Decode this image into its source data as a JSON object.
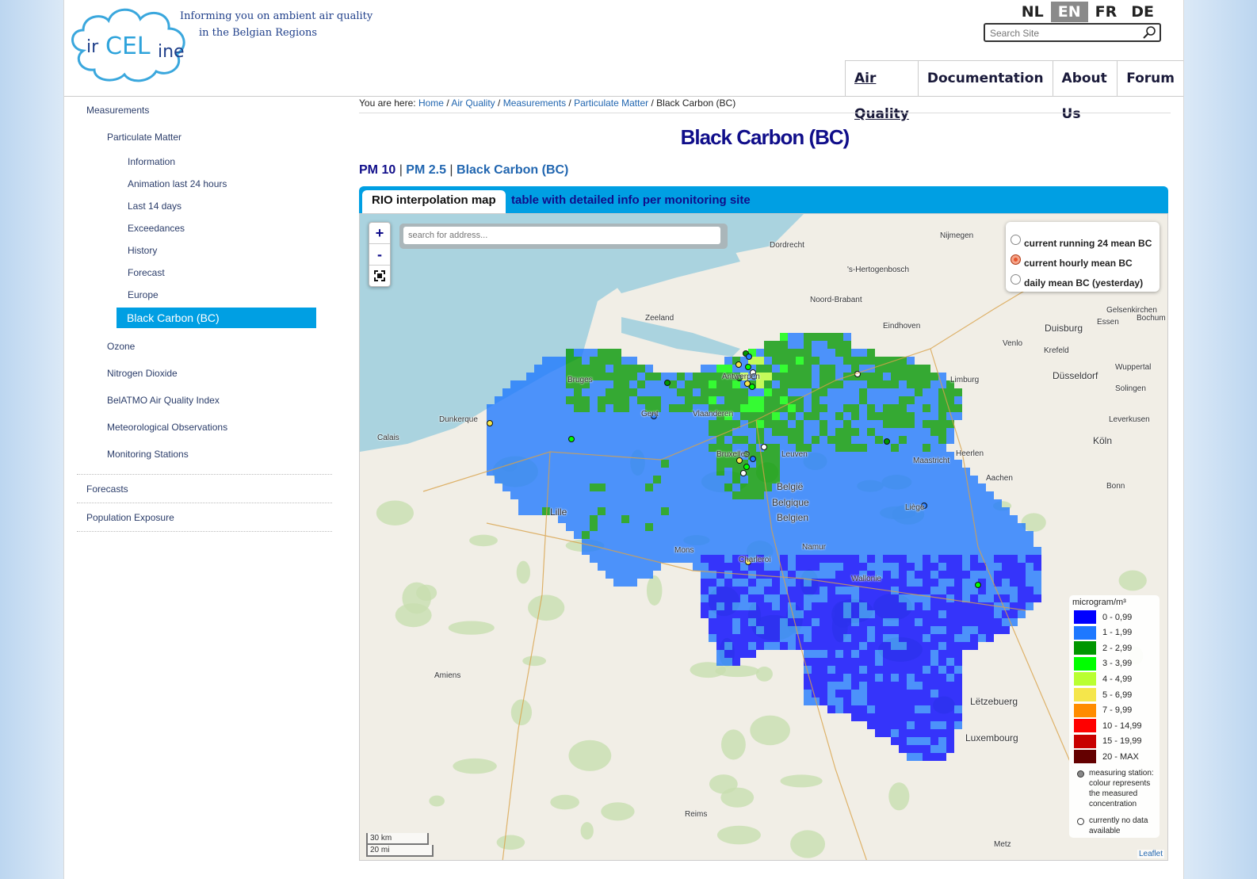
{
  "header": {
    "logo_text_ir": "ir",
    "logo_text_celine": "CEL",
    "logo_text_ine": "ine",
    "tagline_line1": "Informing you on ambient air quality",
    "tagline_line2": "in the Belgian Regions",
    "languages": [
      "NL",
      "EN",
      "FR",
      "DE"
    ],
    "active_language": "EN",
    "search_placeholder": "Search Site",
    "nav": [
      "Air Quality",
      "Documentation",
      "About Us",
      "Forum"
    ]
  },
  "sidebar": {
    "measurements": "Measurements",
    "particulate_matter": "Particulate Matter",
    "pm_items": [
      "Information",
      "Animation last 24 hours",
      "Last 14 days",
      "Exceedances",
      "History",
      "Forecast",
      "Europe"
    ],
    "current": "Black Carbon (BC)",
    "other": [
      "Ozone",
      "Nitrogen Dioxide",
      "BelATMO Air Quality Index",
      "Meteorological Observations",
      "Monitoring Stations"
    ],
    "forecasts": "Forecasts",
    "population": "Population Exposure"
  },
  "breadcrumb": {
    "prefix": "You are here:",
    "links": [
      "Home",
      "Air Quality",
      "Measurements",
      "Particulate Matter"
    ],
    "current": "Black Carbon (BC)"
  },
  "page_title": "Black Carbon (BC)",
  "subnav": {
    "pm10": "PM 10",
    "pm25": "PM 2.5",
    "bc": "Black Carbon (BC)"
  },
  "tabs": {
    "active": "RIO interpolation map",
    "other": "table with detailed info per monitoring site"
  },
  "map": {
    "zoom_in": "+",
    "zoom_out": "-",
    "address_placeholder": "search for address...",
    "options": [
      "current running 24 mean BC",
      "current hourly mean BC",
      "daily mean BC (yesterday)"
    ],
    "selected_option": 1,
    "legend_unit": "microgram/m³",
    "legend": [
      {
        "label": "0 - 0,99",
        "color": "#0000ff"
      },
      {
        "label": "1 - 1,99",
        "color": "#1e78ff"
      },
      {
        "label": "2 - 2,99",
        "color": "#009600"
      },
      {
        "label": "3 - 3,99",
        "color": "#00ff00"
      },
      {
        "label": "4 - 4,99",
        "color": "#b9ff32"
      },
      {
        "label": "5 - 6,99",
        "color": "#f5e64b"
      },
      {
        "label": "7 - 9,99",
        "color": "#ff8c00"
      },
      {
        "label": "10 - 14,99",
        "color": "#ff0000"
      },
      {
        "label": "15 - 19,99",
        "color": "#c80000"
      },
      {
        "label": "20 - MAX",
        "color": "#640000"
      }
    ],
    "note_station": "measuring station: colour represents the measured concentration",
    "note_nodata": "currently no data available",
    "scale_km": "30 km",
    "scale_mi": "20 mi",
    "attribution": "Leaflet",
    "places": [
      {
        "name": "Nijmegen"
      },
      {
        "name": "Dordrecht"
      },
      {
        "name": "'s-Hertogenbosch"
      },
      {
        "name": "Noord-Brabant"
      },
      {
        "name": "Eindhoven"
      },
      {
        "name": "Duisburg"
      },
      {
        "name": "Essen"
      },
      {
        "name": "Gelsenkirchen"
      },
      {
        "name": "Bochum"
      },
      {
        "name": "Venlo"
      },
      {
        "name": "Krefeld"
      },
      {
        "name": "Düsseldorf"
      },
      {
        "name": "Wuppertal"
      },
      {
        "name": "Solingen"
      },
      {
        "name": "Leverkusen"
      },
      {
        "name": "Köln"
      },
      {
        "name": "Bonn"
      },
      {
        "name": "Aachen"
      },
      {
        "name": "Heerlen"
      },
      {
        "name": "Maastricht"
      },
      {
        "name": "Limburg"
      },
      {
        "name": "Zeeland"
      },
      {
        "name": "Bruges"
      },
      {
        "name": "Antwerpen"
      },
      {
        "name": "Gent"
      },
      {
        "name": "Vlaanderen"
      },
      {
        "name": "Dunkerque"
      },
      {
        "name": "Calais"
      },
      {
        "name": "Bruxelles"
      },
      {
        "name": "Leuven"
      },
      {
        "name": "België"
      },
      {
        "name": "Belgique"
      },
      {
        "name": "Belgien"
      },
      {
        "name": "Lille"
      },
      {
        "name": "Liège"
      },
      {
        "name": "Namur"
      },
      {
        "name": "Mons"
      },
      {
        "name": "Charleroi"
      },
      {
        "name": "Wallonie"
      },
      {
        "name": "Amiens"
      },
      {
        "name": "Lëtzebuerg"
      },
      {
        "name": "Luxembourg"
      },
      {
        "name": "Reims"
      },
      {
        "name": "Metz"
      }
    ]
  }
}
